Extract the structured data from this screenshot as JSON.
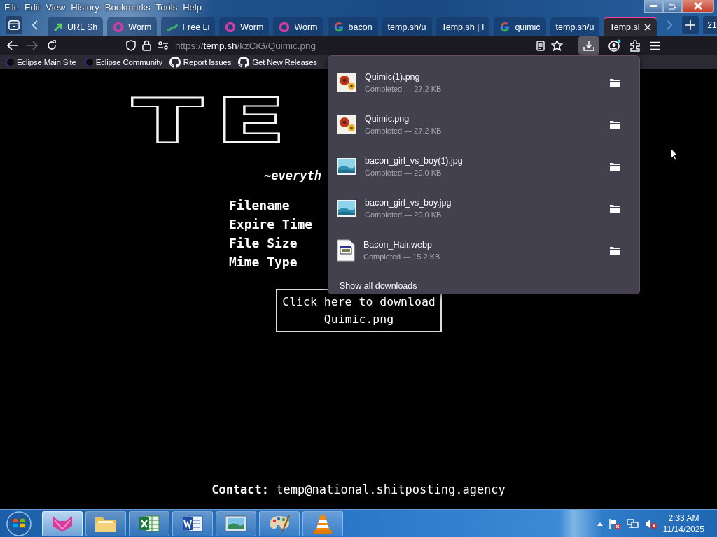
{
  "menu_bar": [
    "File",
    "Edit",
    "View",
    "History",
    "Bookmarks",
    "Tools",
    "Help"
  ],
  "tabs": [
    {
      "label": "URL Sh",
      "kind": "arrow",
      "selected": false
    },
    {
      "label": "Worm",
      "kind": "ring",
      "selected": false
    },
    {
      "label": "Free Li",
      "kind": "snake",
      "selected": false
    },
    {
      "label": "Worm",
      "kind": "ring",
      "selected": false
    },
    {
      "label": "Worm",
      "kind": "ring",
      "selected": false
    },
    {
      "label": "bacon",
      "kind": "google",
      "selected": false
    },
    {
      "label": "temp.sh/u",
      "kind": "plain",
      "selected": false
    },
    {
      "label": "Temp.sh | I",
      "kind": "plain",
      "selected": false
    },
    {
      "label": "quimic",
      "kind": "google",
      "selected": false
    },
    {
      "label": "temp.sh/u",
      "kind": "plain",
      "selected": false
    },
    {
      "label": "Temp.sl",
      "kind": "plain",
      "selected": true
    }
  ],
  "tab_count": "21",
  "navigation": {
    "forward_disabled": true
  },
  "address_bar": {
    "scheme": "https://",
    "host": "temp.sh",
    "path": "/kzCiG/Quimic.png"
  },
  "bookmarks": [
    {
      "label": "Eclipse Main Site",
      "kind": "eclipse"
    },
    {
      "label": "Eclipse Community",
      "kind": "eclipse"
    },
    {
      "label": "Report Issues",
      "kind": "github"
    },
    {
      "label": "Get New Releases",
      "kind": "github"
    }
  ],
  "page": {
    "logo": "TE",
    "tagline": "~everyth",
    "labels": [
      "Filename",
      "Expire Time",
      "File Size",
      "Mime Type"
    ],
    "download_button": "Click here to download Quimic.png",
    "contact_label": "Contact:",
    "contact_email": "temp@national.shitposting.agency"
  },
  "downloads_panel": {
    "items": [
      {
        "name": "Quimic(1).png",
        "status": "Completed — 27.2 KB",
        "kind": "flower"
      },
      {
        "name": "Quimic.png",
        "status": "Completed — 27.2 KB",
        "kind": "flower"
      },
      {
        "name": "bacon_girl_vs_boy(1).jpg",
        "status": "Completed — 29.0 KB",
        "kind": "landscape"
      },
      {
        "name": "bacon_girl_vs_boy.jpg",
        "status": "Completed — 29.0 KB",
        "kind": "landscape"
      },
      {
        "name": "Bacon_Hair.webp",
        "status": "Completed — 15.2 KB",
        "kind": "document"
      }
    ],
    "show_all": "Show all downloads"
  },
  "taskbar": {
    "apps": [
      {
        "kind": "cat",
        "selected": true
      },
      {
        "kind": "folder",
        "selected": false
      },
      {
        "kind": "excel",
        "selected": false
      },
      {
        "kind": "word",
        "selected": false
      },
      {
        "kind": "photo",
        "selected": false
      },
      {
        "kind": "paint",
        "selected": false
      },
      {
        "kind": "cone",
        "selected": false
      }
    ],
    "time": "2:33 AM",
    "date": "11/14/2025"
  }
}
